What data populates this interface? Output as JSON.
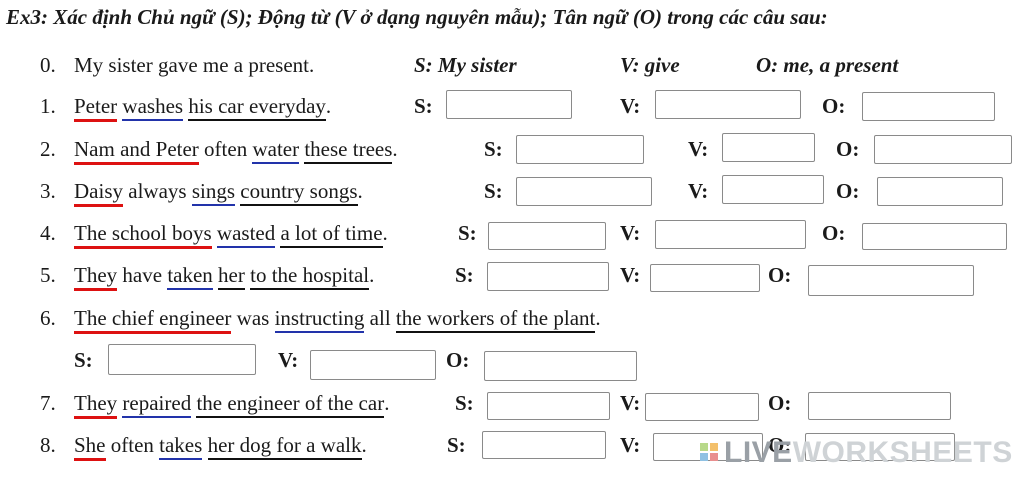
{
  "title": "Ex3: Xác định Chủ ngữ (S); Động từ (V ở dạng nguyên mẫu); Tân ngữ (O) trong các câu sau:",
  "example": {
    "num": "0.",
    "sentence": "My sister gave me a present.",
    "s": "S: My sister",
    "v": "V: give",
    "o": "O: me, a present"
  },
  "labels": {
    "s": "S:",
    "v": "V:",
    "o": "O:"
  },
  "items": [
    {
      "num": "1.",
      "w": [
        "Peter",
        " ",
        "washes",
        " ",
        "his car everyday",
        "."
      ]
    },
    {
      "num": "2.",
      "w": [
        "Nam and Peter",
        " often ",
        "water",
        " ",
        "these trees",
        "."
      ]
    },
    {
      "num": "3.",
      "w": [
        "Daisy",
        " always ",
        "sings",
        " ",
        "country songs",
        "."
      ]
    },
    {
      "num": "4.",
      "w": [
        "The school boys",
        " ",
        "wasted",
        " ",
        "a lot of time",
        "."
      ]
    },
    {
      "num": "5.",
      "w": [
        "They",
        " have ",
        "taken",
        " ",
        "her",
        " ",
        "to the hospital",
        "."
      ]
    },
    {
      "num": "6.",
      "w": [
        "The chief engineer",
        " was ",
        "instructing",
        " all ",
        "the workers of the plant",
        "."
      ]
    },
    {
      "num": "7.",
      "w": [
        "They",
        " ",
        "repaired",
        " ",
        "the engineer of the car",
        "."
      ]
    },
    {
      "num": "8.",
      "w": [
        "She",
        " often ",
        "takes",
        " ",
        "her dog for a walk",
        "."
      ]
    }
  ],
  "answers": {
    "q1": {
      "s": "",
      "v": "",
      "o": ""
    },
    "q2": {
      "s": "",
      "v": "",
      "o": ""
    },
    "q3": {
      "s": "",
      "v": "",
      "o": ""
    },
    "q4": {
      "s": "",
      "v": "",
      "o": ""
    },
    "q5": {
      "s": "",
      "v": "",
      "o": ""
    },
    "q6": {
      "s": "",
      "v": "",
      "o": ""
    },
    "q7": {
      "s": "",
      "v": "",
      "o": ""
    },
    "q8": {
      "s": "",
      "v": "",
      "o": ""
    }
  },
  "watermark": {
    "part1": "LIVE",
    "part2": "WORKSHEETS"
  },
  "colors": {
    "subject_underline": "#dd1111",
    "verb_underline": "#2233aa",
    "object_underline": "#111111"
  }
}
